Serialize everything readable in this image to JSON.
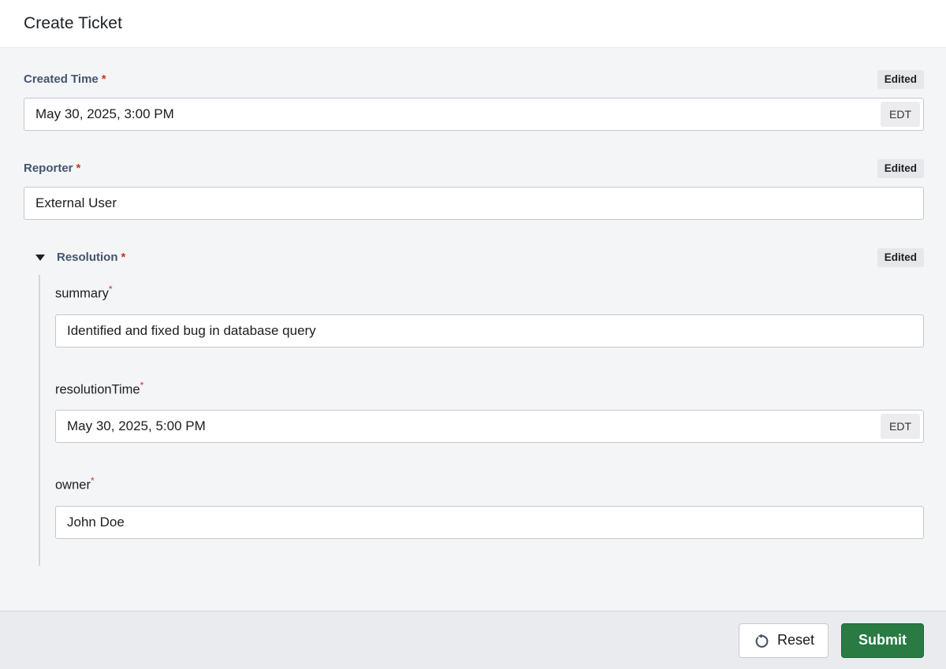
{
  "header": {
    "title": "Create Ticket"
  },
  "required_marker": "*",
  "form": {
    "created_time": {
      "label": "Created Time",
      "value": "May 30, 2025, 3:00 PM",
      "timezone": "EDT",
      "badge": "Edited"
    },
    "reporter": {
      "label": "Reporter",
      "value": "External User",
      "badge": "Edited"
    },
    "resolution": {
      "label": "Resolution",
      "badge": "Edited",
      "summary": {
        "label": "summary",
        "value": "Identified and fixed bug in database query"
      },
      "resolution_time": {
        "label": "resolutionTime",
        "value": "May 30, 2025, 5:00 PM",
        "timezone": "EDT"
      },
      "owner": {
        "label": "owner",
        "value": "John Doe"
      }
    }
  },
  "footer": {
    "reset_label": "Reset",
    "submit_label": "Submit"
  },
  "colors": {
    "submit_green": "#2a7a44",
    "label_blue": "#44546f",
    "required_red": "#ca3521",
    "badge_gray": "#e5e7ea",
    "body_bg": "#f4f5f7",
    "footer_bg": "#e9ebee"
  }
}
